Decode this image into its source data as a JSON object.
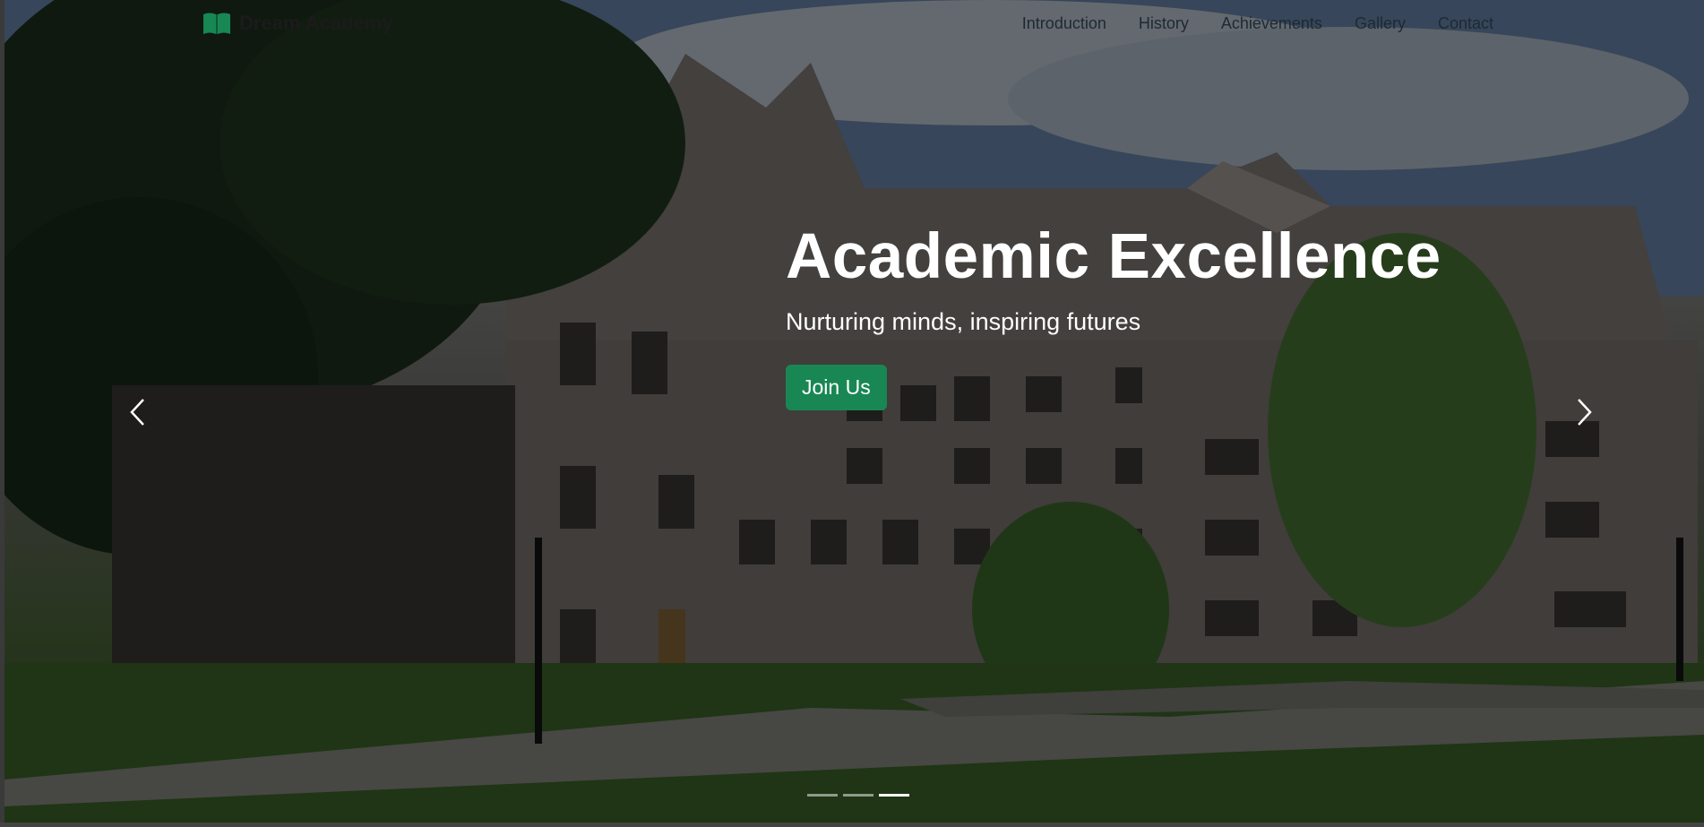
{
  "brand": {
    "name": "Dream Academy",
    "icon": "open-book-icon",
    "icon_color": "#198754"
  },
  "nav": {
    "links": [
      {
        "label": "Introduction"
      },
      {
        "label": "History"
      },
      {
        "label": "Achievements"
      },
      {
        "label": "Gallery"
      },
      {
        "label": "Contact"
      }
    ]
  },
  "hero": {
    "title": "Academic Excellence",
    "subtitle": "Nurturing minds, inspiring futures",
    "cta_label": "Join Us",
    "cta_color": "#198754",
    "background": "campus-building-photo"
  },
  "carousel": {
    "prev_icon": "chevron-left-icon",
    "next_icon": "chevron-right-icon",
    "slide_count": 3,
    "active_index": 2
  }
}
